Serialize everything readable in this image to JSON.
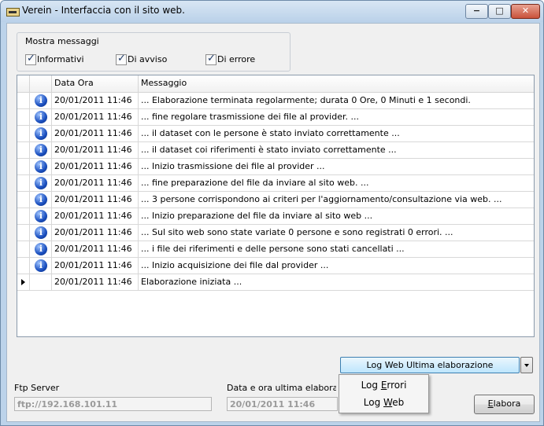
{
  "window": {
    "title": "Verein - Interfaccia con il sito web.",
    "minimize": "−",
    "maximize": "□",
    "close": "✕"
  },
  "filter": {
    "title": "Mostra messaggi",
    "options": [
      {
        "label": "Informativi",
        "checked": true
      },
      {
        "label": "Di avviso",
        "checked": true
      },
      {
        "label": "Di errore",
        "checked": true
      }
    ]
  },
  "grid": {
    "columns": [
      "",
      "",
      "Data Ora",
      "Messaggio"
    ],
    "rows": [
      {
        "datetime": "20/01/2011 11:46",
        "message": "... Elaborazione terminata regolarmente; durata 0 Ore, 0 Minuti e 1 secondi.",
        "icon": "info-icon"
      },
      {
        "datetime": "20/01/2011 11:46",
        "message": "... fine regolare trasmissione dei file al provider. ...",
        "icon": "info-icon"
      },
      {
        "datetime": "20/01/2011 11:46",
        "message": "... il dataset con le persone è stato inviato correttamente ...",
        "icon": "info-icon"
      },
      {
        "datetime": "20/01/2011 11:46",
        "message": "... il dataset coi riferimenti è stato inviato correttamente ...",
        "icon": "info-icon"
      },
      {
        "datetime": "20/01/2011 11:46",
        "message": "... Inizio trasmissione dei file al provider ...",
        "icon": "info-icon"
      },
      {
        "datetime": "20/01/2011 11:46",
        "message": "... fine preparazione del file da inviare al sito web. ...",
        "icon": "info-icon"
      },
      {
        "datetime": "20/01/2011 11:46",
        "message": "... 3 persone corrispondono ai criteri per l'aggiornamento/consultazione via web. ...",
        "icon": "info-icon"
      },
      {
        "datetime": "20/01/2011 11:46",
        "message": "... Inizio preparazione del file da inviare al sito web ...",
        "icon": "info-icon"
      },
      {
        "datetime": "20/01/2011 11:46",
        "message": "... Sul sito web sono state variate 0 persone e  sono registrati 0 errori. ...",
        "icon": "info-icon"
      },
      {
        "datetime": "20/01/2011 11:46",
        "message": "... i file dei riferimenti e delle persone sono stati cancellati ...",
        "icon": "info-icon"
      },
      {
        "datetime": "20/01/2011 11:46",
        "message": "... Inizio acquisizione dei file dal provider ...",
        "icon": "info-icon"
      },
      {
        "datetime": "20/01/2011 11:46",
        "message": "Elaborazione iniziata ...",
        "icon": "",
        "current": true
      }
    ]
  },
  "log_button": {
    "label": "Log Web Ultima elaborazione"
  },
  "log_menu": {
    "items": [
      {
        "pre": "Log ",
        "ul": "E",
        "post": "rrori"
      },
      {
        "pre": "Log ",
        "ul": "W",
        "post": "eb"
      }
    ]
  },
  "ftp": {
    "label": "Ftp Server",
    "value": "ftp://192.168.101.11"
  },
  "last_run": {
    "label": "Data e ora ultima elaborazione",
    "value": "20/01/2011 11:46"
  },
  "elabora": {
    "ul": "E",
    "rest": "labora"
  },
  "info_glyph": "i"
}
